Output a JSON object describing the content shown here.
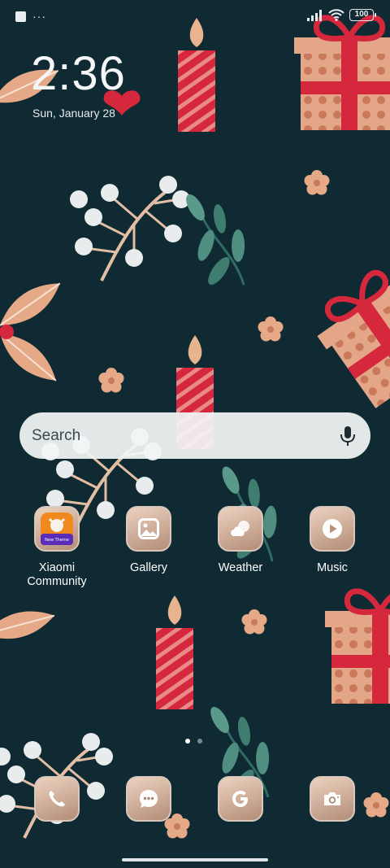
{
  "status_bar": {
    "left_more": "···",
    "battery": "100"
  },
  "lock": {
    "time": "2:36",
    "date": "Sun, January 28"
  },
  "search": {
    "placeholder": "Search"
  },
  "apps": [
    {
      "label": "Xiaomi Community",
      "icon": "xiaomi-community-icon",
      "badge": "New Theme"
    },
    {
      "label": "Gallery",
      "icon": "gallery-icon"
    },
    {
      "label": "Weather",
      "icon": "weather-icon"
    },
    {
      "label": "Music",
      "icon": "music-icon"
    }
  ],
  "dock": [
    {
      "icon": "phone-icon"
    },
    {
      "icon": "messages-icon"
    },
    {
      "icon": "google-icon"
    },
    {
      "icon": "camera-icon"
    }
  ],
  "colors": {
    "background": "#0f2a32",
    "icon_frame": "#ecd2bf",
    "red": "#d6283c",
    "peach": "#e6a987"
  }
}
